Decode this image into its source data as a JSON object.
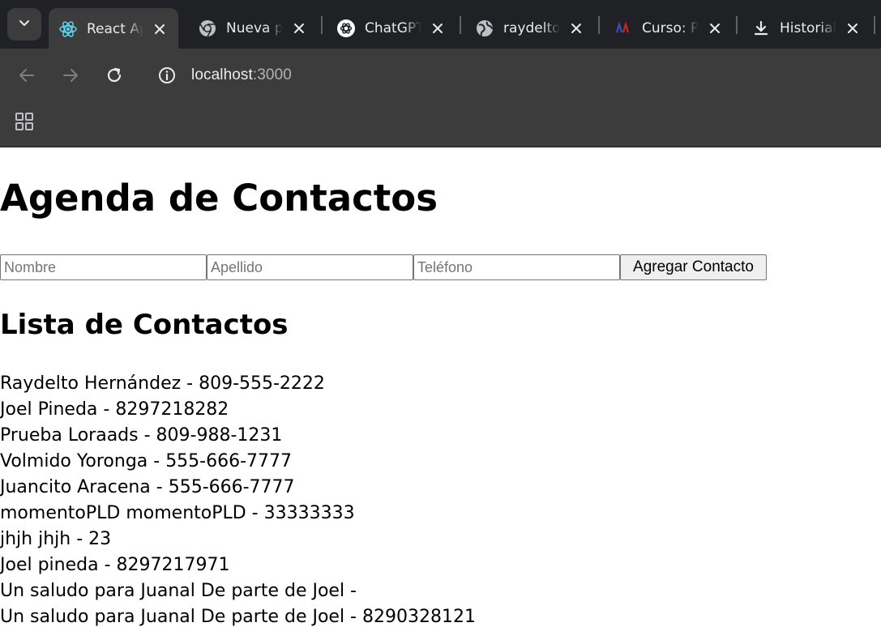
{
  "browser": {
    "tabs": [
      {
        "title": "React App",
        "icon": "react-icon",
        "active": true
      },
      {
        "title": "Nueva pestaña",
        "icon": "chrome-icon",
        "active": false
      },
      {
        "title": "ChatGPT",
        "icon": "chatgpt-icon",
        "active": false
      },
      {
        "title": "raydelto",
        "icon": "globe-icon",
        "active": false
      },
      {
        "title": "Curso: P",
        "icon": "course-icon",
        "active": false
      },
      {
        "title": "Historial",
        "icon": "download-icon",
        "active": false
      }
    ],
    "url_host": "localhost",
    "url_port": ":3000"
  },
  "page": {
    "title": "Agenda de Contactos",
    "form": {
      "nombre_placeholder": "Nombre",
      "apellido_placeholder": "Apellido",
      "telefono_placeholder": "Teléfono",
      "submit_label": "Agregar Contacto"
    },
    "list_title": "Lista de Contactos",
    "contacts": [
      "Raydelto Hernández - 809-555-2222",
      "Joel Pineda - 8297218282",
      "Prueba Loraads - 809-988-1231",
      "Volmido Yoronga - 555-666-7777",
      "Juancito Aracena - 555-666-7777",
      "momentoPLD momentoPLD - 33333333",
      "jhjh jhjh - 23",
      "Joel pineda - 8297217971",
      "Un saludo para Juanal De parte de Joel -",
      "Un saludo para Juanal De parte de Joel - 8290328121"
    ]
  },
  "colors": {
    "tabbar_bg": "#202124",
    "toolbar_bg": "#3c3c3c",
    "chrome_text": "#e8eaed"
  }
}
